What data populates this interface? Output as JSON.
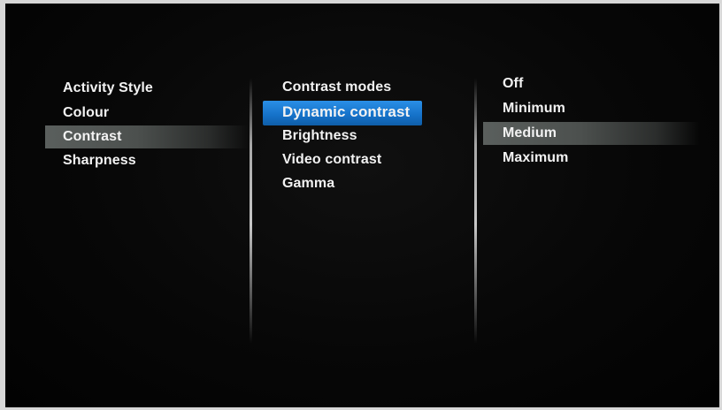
{
  "menu": {
    "level1": {
      "items": [
        "Activity Style",
        "Colour",
        "Contrast",
        "Sharpness"
      ],
      "selected_index": 2
    },
    "level2": {
      "items": [
        "Contrast modes",
        "Dynamic contrast",
        "Brightness",
        "Video contrast",
        "Gamma"
      ],
      "focused_index": 1
    },
    "level3": {
      "items": [
        "Off",
        "Minimum",
        "Medium",
        "Maximum"
      ],
      "selected_index": 2
    }
  },
  "colors": {
    "focus_highlight": "#1571c8",
    "selection_highlight": "#555a58",
    "text": "#f2f2f2",
    "background": "#050505"
  }
}
